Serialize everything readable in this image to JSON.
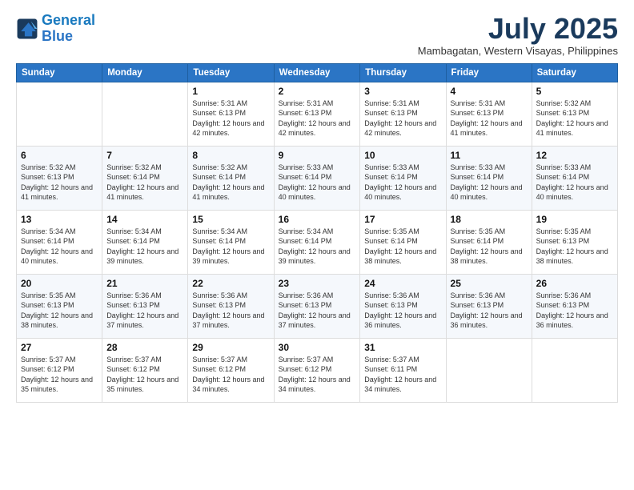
{
  "logo": {
    "line1": "General",
    "line2": "Blue"
  },
  "title": "July 2025",
  "subtitle": "Mambagatan, Western Visayas, Philippines",
  "days_header": [
    "Sunday",
    "Monday",
    "Tuesday",
    "Wednesday",
    "Thursday",
    "Friday",
    "Saturday"
  ],
  "weeks": [
    [
      {
        "day": "",
        "info": ""
      },
      {
        "day": "",
        "info": ""
      },
      {
        "day": "1",
        "info": "Sunrise: 5:31 AM\nSunset: 6:13 PM\nDaylight: 12 hours and 42 minutes."
      },
      {
        "day": "2",
        "info": "Sunrise: 5:31 AM\nSunset: 6:13 PM\nDaylight: 12 hours and 42 minutes."
      },
      {
        "day": "3",
        "info": "Sunrise: 5:31 AM\nSunset: 6:13 PM\nDaylight: 12 hours and 42 minutes."
      },
      {
        "day": "4",
        "info": "Sunrise: 5:31 AM\nSunset: 6:13 PM\nDaylight: 12 hours and 41 minutes."
      },
      {
        "day": "5",
        "info": "Sunrise: 5:32 AM\nSunset: 6:13 PM\nDaylight: 12 hours and 41 minutes."
      }
    ],
    [
      {
        "day": "6",
        "info": "Sunrise: 5:32 AM\nSunset: 6:13 PM\nDaylight: 12 hours and 41 minutes."
      },
      {
        "day": "7",
        "info": "Sunrise: 5:32 AM\nSunset: 6:14 PM\nDaylight: 12 hours and 41 minutes."
      },
      {
        "day": "8",
        "info": "Sunrise: 5:32 AM\nSunset: 6:14 PM\nDaylight: 12 hours and 41 minutes."
      },
      {
        "day": "9",
        "info": "Sunrise: 5:33 AM\nSunset: 6:14 PM\nDaylight: 12 hours and 40 minutes."
      },
      {
        "day": "10",
        "info": "Sunrise: 5:33 AM\nSunset: 6:14 PM\nDaylight: 12 hours and 40 minutes."
      },
      {
        "day": "11",
        "info": "Sunrise: 5:33 AM\nSunset: 6:14 PM\nDaylight: 12 hours and 40 minutes."
      },
      {
        "day": "12",
        "info": "Sunrise: 5:33 AM\nSunset: 6:14 PM\nDaylight: 12 hours and 40 minutes."
      }
    ],
    [
      {
        "day": "13",
        "info": "Sunrise: 5:34 AM\nSunset: 6:14 PM\nDaylight: 12 hours and 40 minutes."
      },
      {
        "day": "14",
        "info": "Sunrise: 5:34 AM\nSunset: 6:14 PM\nDaylight: 12 hours and 39 minutes."
      },
      {
        "day": "15",
        "info": "Sunrise: 5:34 AM\nSunset: 6:14 PM\nDaylight: 12 hours and 39 minutes."
      },
      {
        "day": "16",
        "info": "Sunrise: 5:34 AM\nSunset: 6:14 PM\nDaylight: 12 hours and 39 minutes."
      },
      {
        "day": "17",
        "info": "Sunrise: 5:35 AM\nSunset: 6:14 PM\nDaylight: 12 hours and 38 minutes."
      },
      {
        "day": "18",
        "info": "Sunrise: 5:35 AM\nSunset: 6:14 PM\nDaylight: 12 hours and 38 minutes."
      },
      {
        "day": "19",
        "info": "Sunrise: 5:35 AM\nSunset: 6:13 PM\nDaylight: 12 hours and 38 minutes."
      }
    ],
    [
      {
        "day": "20",
        "info": "Sunrise: 5:35 AM\nSunset: 6:13 PM\nDaylight: 12 hours and 38 minutes."
      },
      {
        "day": "21",
        "info": "Sunrise: 5:36 AM\nSunset: 6:13 PM\nDaylight: 12 hours and 37 minutes."
      },
      {
        "day": "22",
        "info": "Sunrise: 5:36 AM\nSunset: 6:13 PM\nDaylight: 12 hours and 37 minutes."
      },
      {
        "day": "23",
        "info": "Sunrise: 5:36 AM\nSunset: 6:13 PM\nDaylight: 12 hours and 37 minutes."
      },
      {
        "day": "24",
        "info": "Sunrise: 5:36 AM\nSunset: 6:13 PM\nDaylight: 12 hours and 36 minutes."
      },
      {
        "day": "25",
        "info": "Sunrise: 5:36 AM\nSunset: 6:13 PM\nDaylight: 12 hours and 36 minutes."
      },
      {
        "day": "26",
        "info": "Sunrise: 5:36 AM\nSunset: 6:13 PM\nDaylight: 12 hours and 36 minutes."
      }
    ],
    [
      {
        "day": "27",
        "info": "Sunrise: 5:37 AM\nSunset: 6:12 PM\nDaylight: 12 hours and 35 minutes."
      },
      {
        "day": "28",
        "info": "Sunrise: 5:37 AM\nSunset: 6:12 PM\nDaylight: 12 hours and 35 minutes."
      },
      {
        "day": "29",
        "info": "Sunrise: 5:37 AM\nSunset: 6:12 PM\nDaylight: 12 hours and 34 minutes."
      },
      {
        "day": "30",
        "info": "Sunrise: 5:37 AM\nSunset: 6:12 PM\nDaylight: 12 hours and 34 minutes."
      },
      {
        "day": "31",
        "info": "Sunrise: 5:37 AM\nSunset: 6:11 PM\nDaylight: 12 hours and 34 minutes."
      },
      {
        "day": "",
        "info": ""
      },
      {
        "day": "",
        "info": ""
      }
    ]
  ]
}
